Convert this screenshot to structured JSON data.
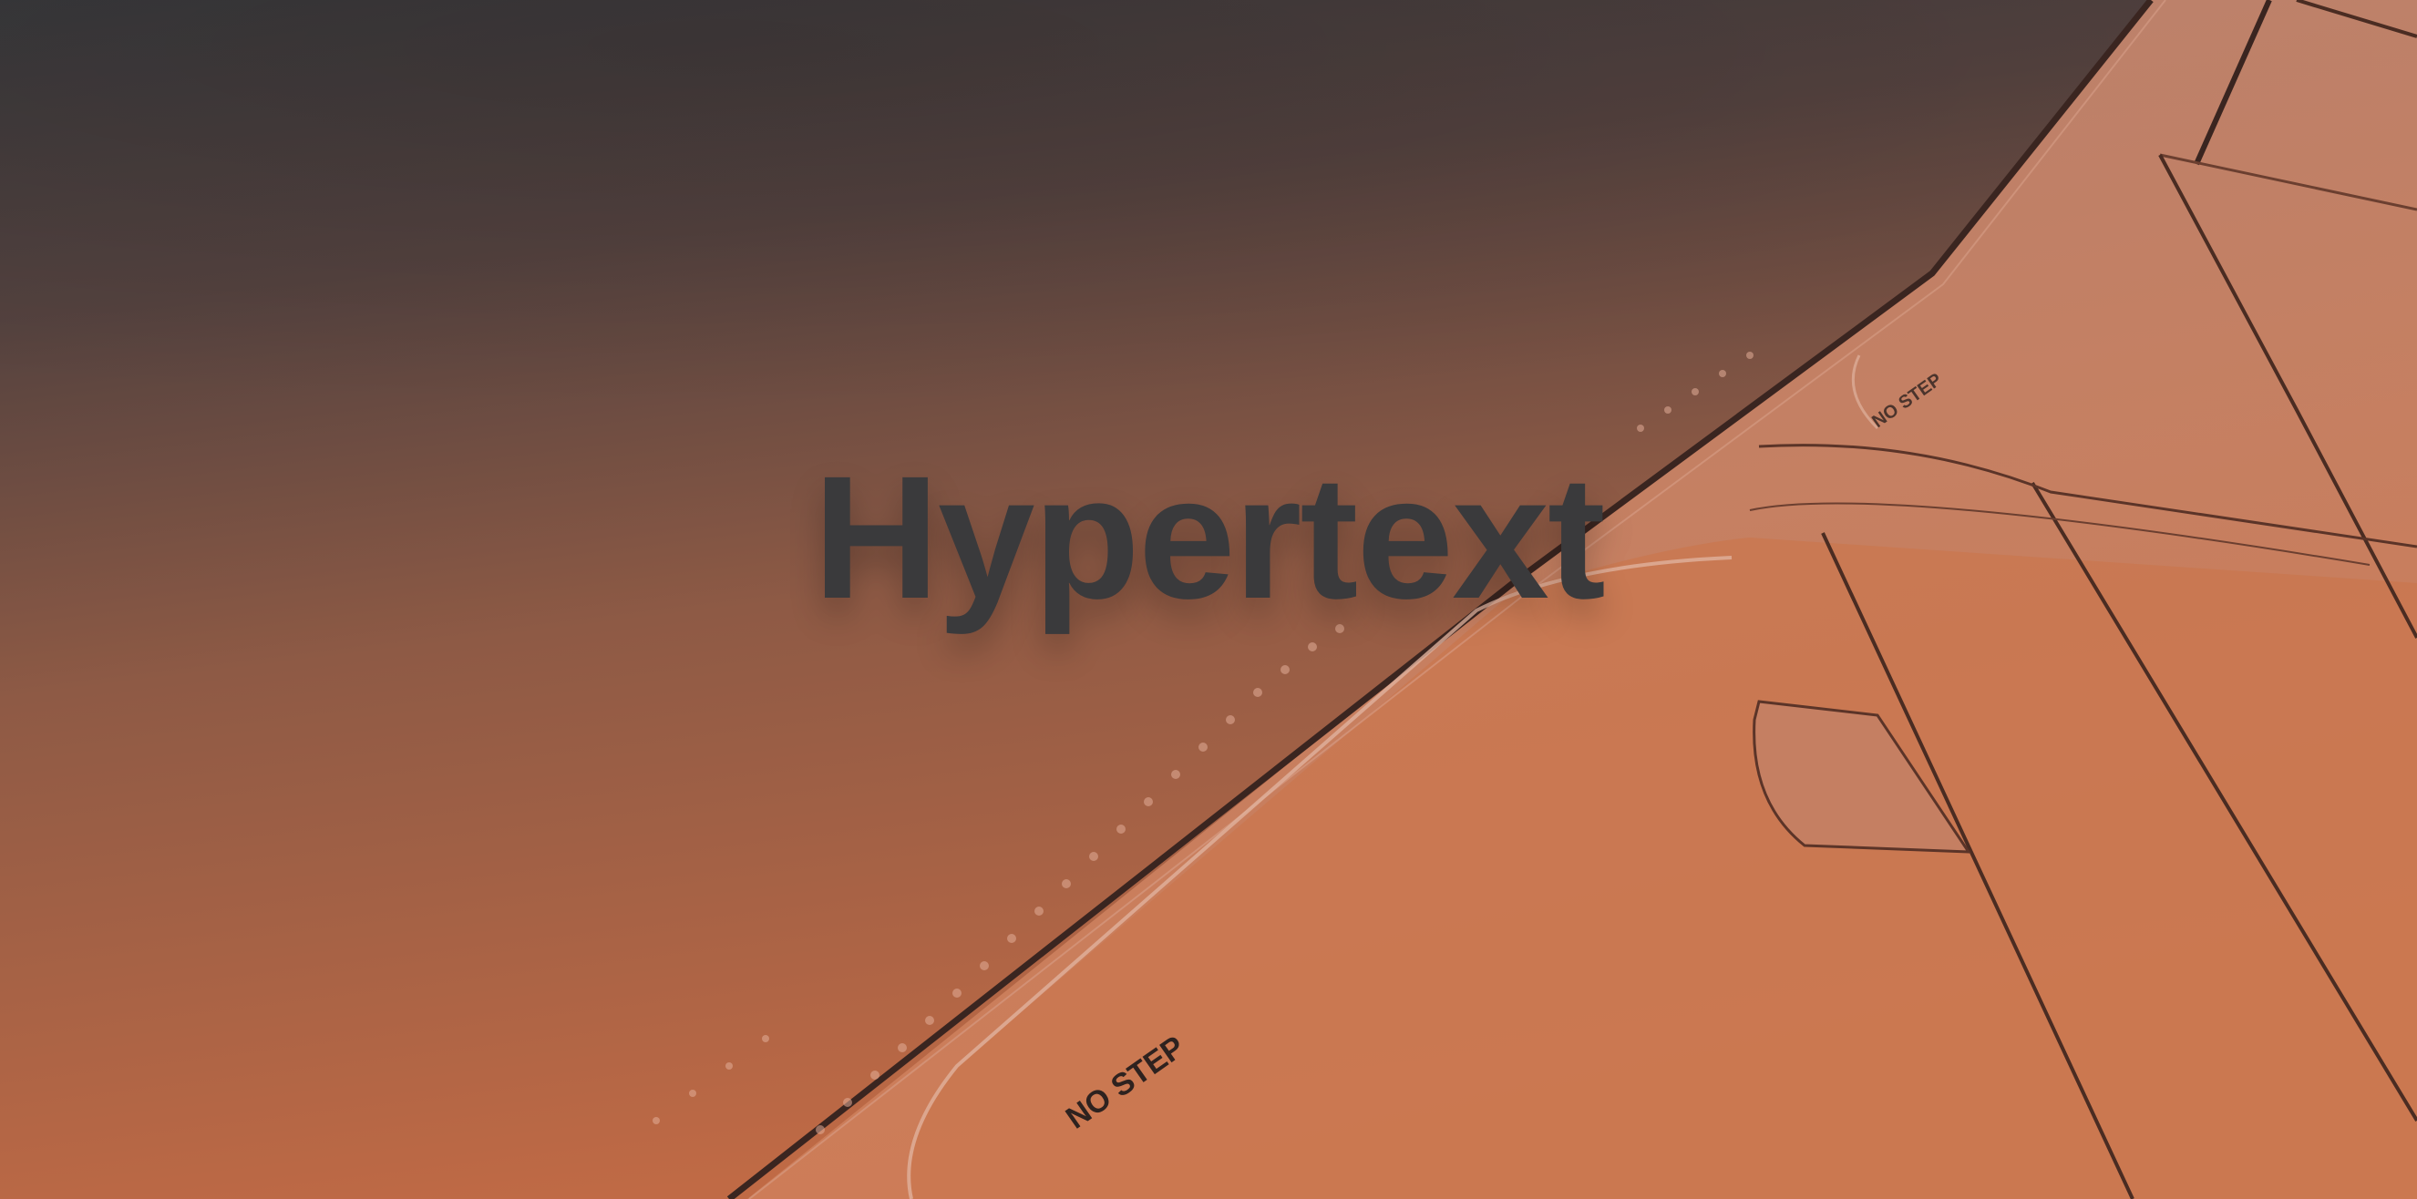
{
  "hero": {
    "title": "Hypertext"
  },
  "photo": {
    "subject": "aircraft-wing-at-sunset",
    "stencils": [
      "NO STEP",
      "NO STEP"
    ]
  },
  "colors": {
    "title_text": "#3a3a3c",
    "sky_top": "#3b3b3e",
    "sky_mid": "#7a5247",
    "wing_lower": "#c8704a",
    "wing_highlight": "#d6825a",
    "seam_line": "#3a2520"
  }
}
